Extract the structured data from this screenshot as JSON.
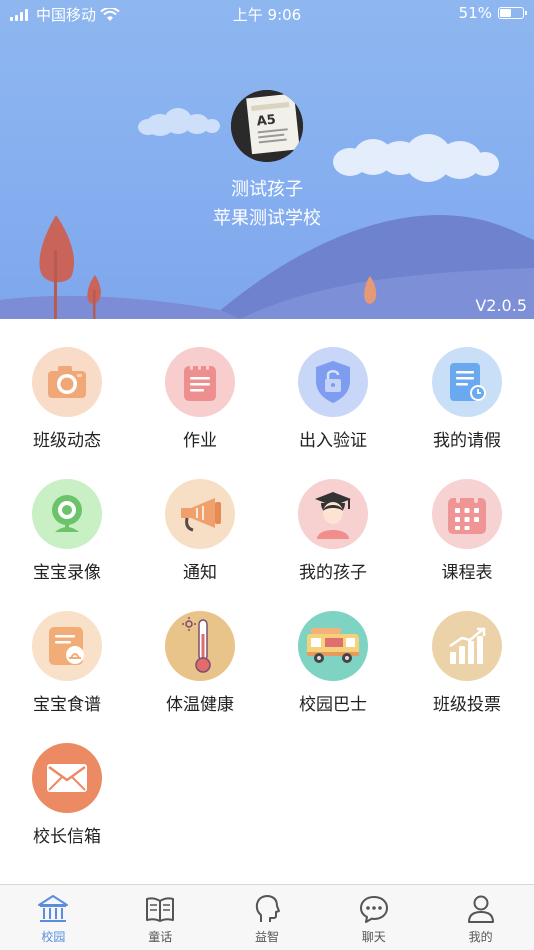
{
  "status_bar": {
    "carrier": "中国移动",
    "time": "上午 9:06",
    "battery": "51%",
    "battery_level": 0.51
  },
  "profile": {
    "child_name": "测试孩子",
    "school_name": "苹果测试学校",
    "avatar_text": "A5"
  },
  "version": "V2.0.5",
  "menu": [
    {
      "label": "班级动态",
      "icon": "camera-icon",
      "color": "#f9dcc7"
    },
    {
      "label": "作业",
      "icon": "homework-notebook-icon",
      "color": "#f7cdcd"
    },
    {
      "label": "出入验证",
      "icon": "shield-lock-icon",
      "color": "#c8d6f7"
    },
    {
      "label": "我的请假",
      "icon": "leave-document-icon",
      "color": "#c9dff8"
    },
    {
      "label": "宝宝录像",
      "icon": "webcam-icon",
      "color": "#c9efc4"
    },
    {
      "label": "通知",
      "icon": "megaphone-icon",
      "color": "#f7dfc6"
    },
    {
      "label": "我的孩子",
      "icon": "graduate-child-icon",
      "color": "#f7d0d0"
    },
    {
      "label": "课程表",
      "icon": "calendar-icon",
      "color": "#f6d2d2"
    },
    {
      "label": "宝宝食谱",
      "icon": "recipe-icon",
      "color": "#f9e0c8"
    },
    {
      "label": "体温健康",
      "icon": "thermometer-icon",
      "color": "#e9c48a"
    },
    {
      "label": "校园巴士",
      "icon": "school-bus-icon",
      "color": "#7fd3c3"
    },
    {
      "label": "班级投票",
      "icon": "vote-chart-icon",
      "color": "#ecd2a8"
    },
    {
      "label": "校长信箱",
      "icon": "mail-icon",
      "color": "#ec8a63"
    }
  ],
  "tabs": [
    {
      "label": "校园",
      "icon": "school-icon",
      "active": true
    },
    {
      "label": "童话",
      "icon": "book-icon",
      "active": false
    },
    {
      "label": "益智",
      "icon": "head-icon",
      "active": false
    },
    {
      "label": "聊天",
      "icon": "chat-icon",
      "active": false
    },
    {
      "label": "我的",
      "icon": "person-icon",
      "active": false
    }
  ]
}
